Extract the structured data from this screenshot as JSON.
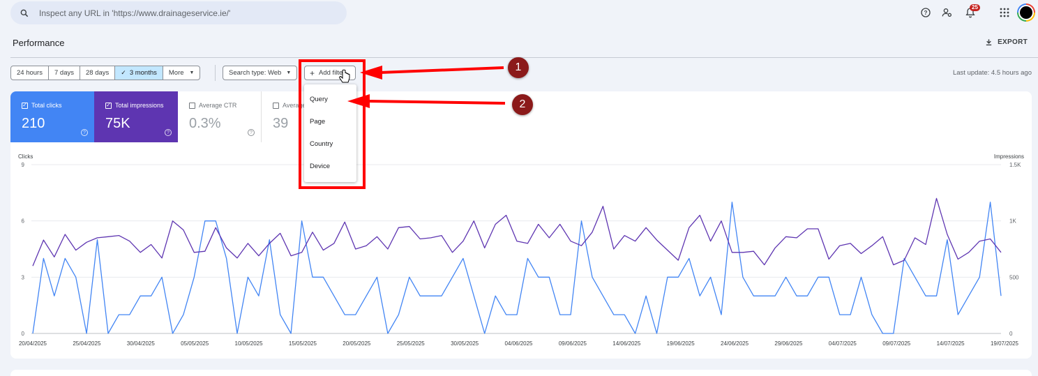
{
  "search": {
    "placeholder": "Inspect any URL in 'https://www.drainageservice.ie/'"
  },
  "header": {
    "notifications_count": "25",
    "title": "Performance",
    "export_label": "EXPORT"
  },
  "filters": {
    "date_ranges": [
      "24 hours",
      "7 days",
      "28 days",
      "3 months",
      "More"
    ],
    "active_range": "3 months",
    "search_type": "Search type: Web",
    "add_filter": "Add filter",
    "last_update": "Last update: 4.5 hours ago"
  },
  "dropdown": {
    "items": [
      "Query",
      "Page",
      "Country",
      "Device"
    ]
  },
  "metrics": [
    {
      "label": "Total clicks",
      "value": "210",
      "checked": true
    },
    {
      "label": "Total impressions",
      "value": "75K",
      "checked": true
    },
    {
      "label": "Average CTR",
      "value": "0.3%",
      "checked": false
    },
    {
      "label": "Average position",
      "value": "39",
      "checked": false
    }
  ],
  "annotations": {
    "badge1": "1",
    "badge2": "2"
  },
  "colors": {
    "clicks": "#4285f4",
    "impressions": "#5e35b1",
    "annotation": "#ff0000",
    "badge": "#8b1a1a"
  },
  "chart_data": {
    "type": "line",
    "ylabel_left": "Clicks",
    "ylabel_right": "Impressions",
    "left_ticks": [
      "0",
      "3",
      "6",
      "9"
    ],
    "right_ticks": [
      "0",
      "500",
      "1K",
      "1.5K"
    ],
    "ylim_left": [
      0,
      9
    ],
    "ylim_right": [
      0,
      1500
    ],
    "x_tick_labels": [
      "20/04/2025",
      "25/04/2025",
      "30/04/2025",
      "05/05/2025",
      "10/05/2025",
      "15/05/2025",
      "20/05/2025",
      "25/05/2025",
      "30/05/2025",
      "04/06/2025",
      "09/06/2025",
      "14/06/2025",
      "19/06/2025",
      "24/06/2025",
      "29/06/2025",
      "04/07/2025",
      "09/07/2025",
      "14/07/2025",
      "19/07/2025"
    ],
    "series": [
      {
        "name": "Clicks",
        "axis": "left",
        "values": [
          0,
          4,
          2,
          4,
          3,
          0,
          5,
          0,
          1,
          1,
          2,
          2,
          3,
          0,
          1,
          3,
          6,
          6,
          4,
          0,
          3,
          2,
          5,
          1,
          0,
          6,
          3,
          3,
          2,
          1,
          1,
          2,
          3,
          0,
          1,
          3,
          2,
          2,
          2,
          3,
          4,
          2,
          0,
          2,
          1,
          1,
          4,
          3,
          3,
          1,
          1,
          6,
          3,
          2,
          1,
          1,
          0,
          2,
          0,
          3,
          3,
          4,
          2,
          3,
          1,
          7,
          3,
          2,
          2,
          2,
          3,
          2,
          2,
          3,
          3,
          1,
          1,
          3,
          1,
          0,
          0,
          4,
          3,
          2,
          2,
          5,
          1,
          2,
          3,
          7,
          2
        ]
      },
      {
        "name": "Impressions",
        "axis": "right",
        "values": [
          600,
          830,
          680,
          880,
          740,
          810,
          850,
          860,
          870,
          820,
          720,
          790,
          670,
          1000,
          920,
          720,
          730,
          940,
          760,
          670,
          800,
          690,
          800,
          890,
          690,
          720,
          900,
          740,
          800,
          990,
          750,
          780,
          860,
          750,
          940,
          950,
          840,
          850,
          870,
          720,
          820,
          1000,
          760,
          970,
          1050,
          820,
          800,
          970,
          850,
          970,
          820,
          780,
          900,
          1130,
          750,
          870,
          820,
          940,
          830,
          740,
          650,
          940,
          1050,
          820,
          1000,
          720,
          720,
          730,
          610,
          760,
          860,
          850,
          930,
          930,
          660,
          780,
          800,
          710,
          780,
          860,
          610,
          650,
          850,
          790,
          1200,
          880,
          660,
          720,
          820,
          840,
          720
        ]
      }
    ]
  }
}
